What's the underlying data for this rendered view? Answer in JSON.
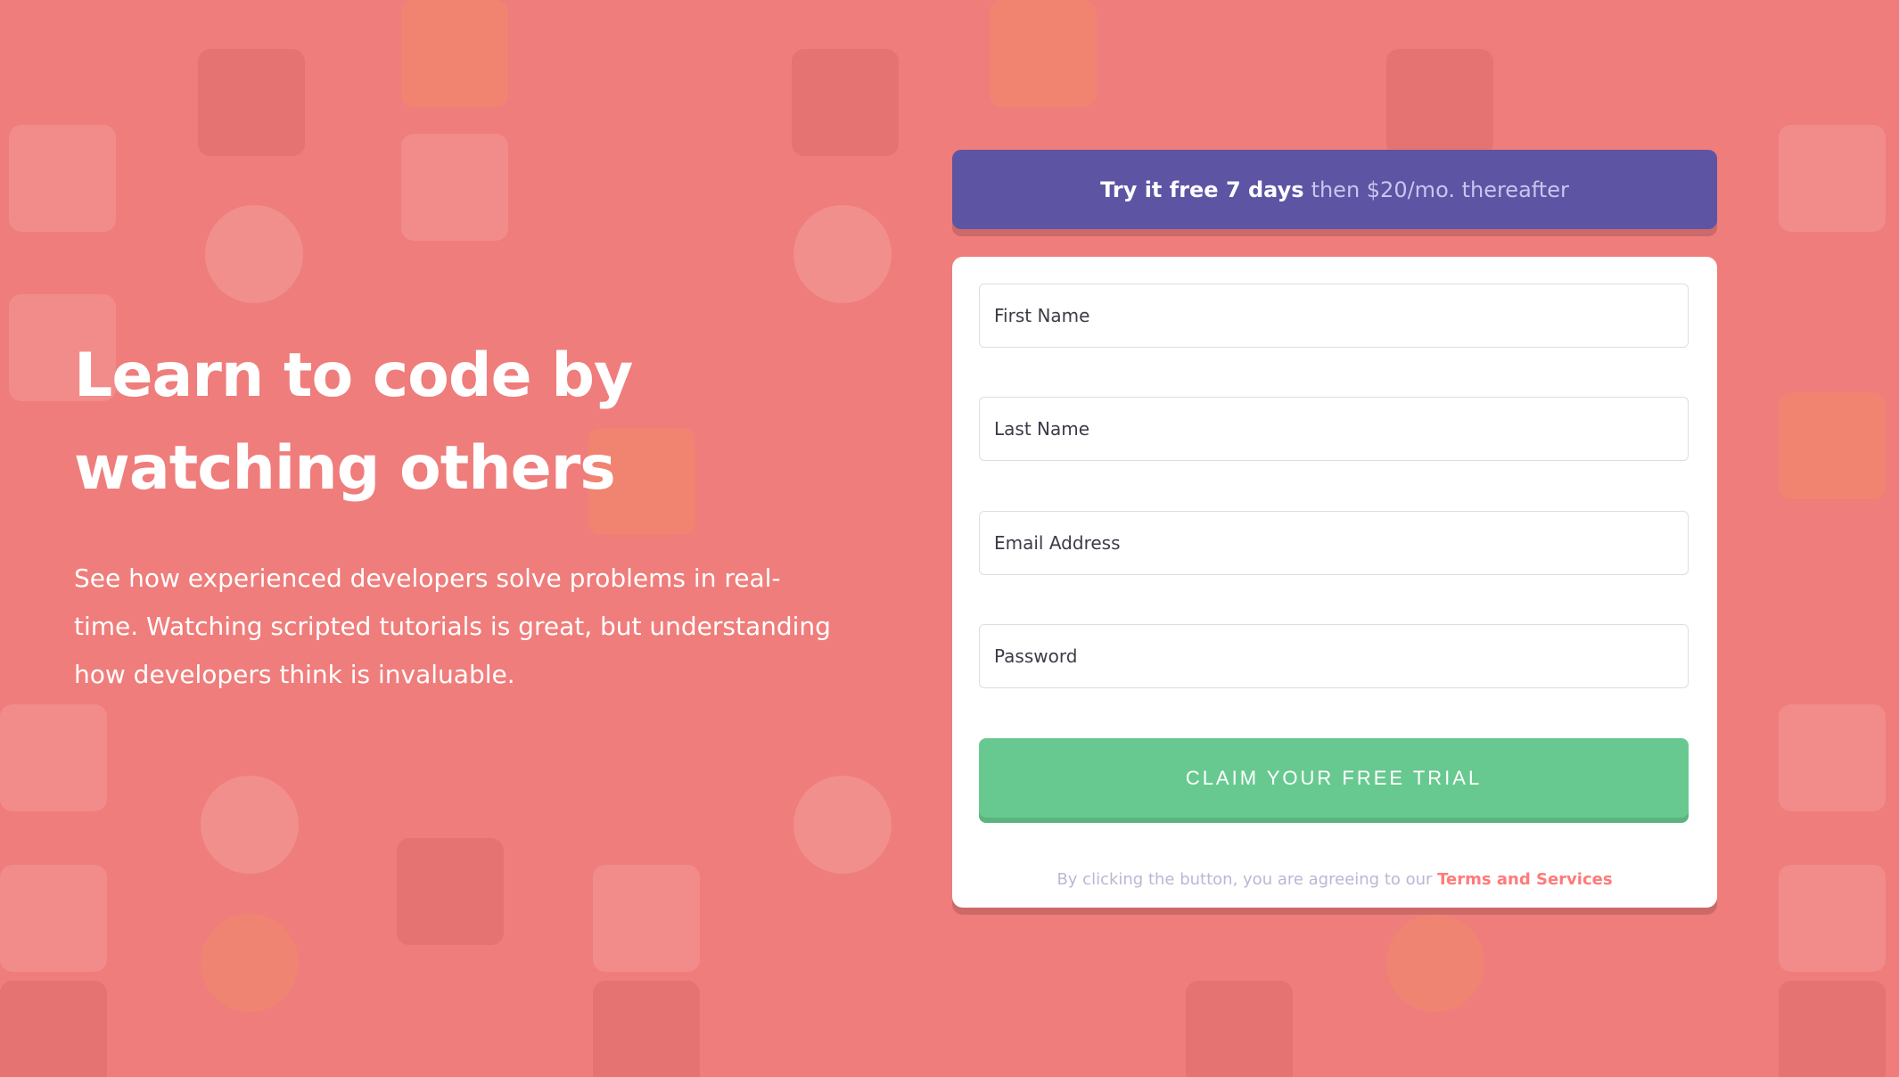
{
  "hero": {
    "title_line1": "Learn to code by",
    "title_line2": "watching others",
    "description": "See how experienced developers solve problems in real-time. Watching scripted tutorials is great, but understanding how developers think is invaluable."
  },
  "offer": {
    "strong": "Try it free 7 days",
    "light": "then $20/mo. thereafter"
  },
  "form": {
    "first_name_placeholder": "First Name",
    "last_name_placeholder": "Last Name",
    "email_placeholder": "Email Address",
    "password_placeholder": "Password",
    "submit_label": "Claim your free trial",
    "terms_prefix": "By clicking the button, you are agreeing to our",
    "terms_link": "Terms and Services"
  },
  "colors": {
    "background": "#ef7d7b",
    "offer_bg": "#5d54a4",
    "cta_bg": "#68c990",
    "link": "#ff7a7a"
  }
}
